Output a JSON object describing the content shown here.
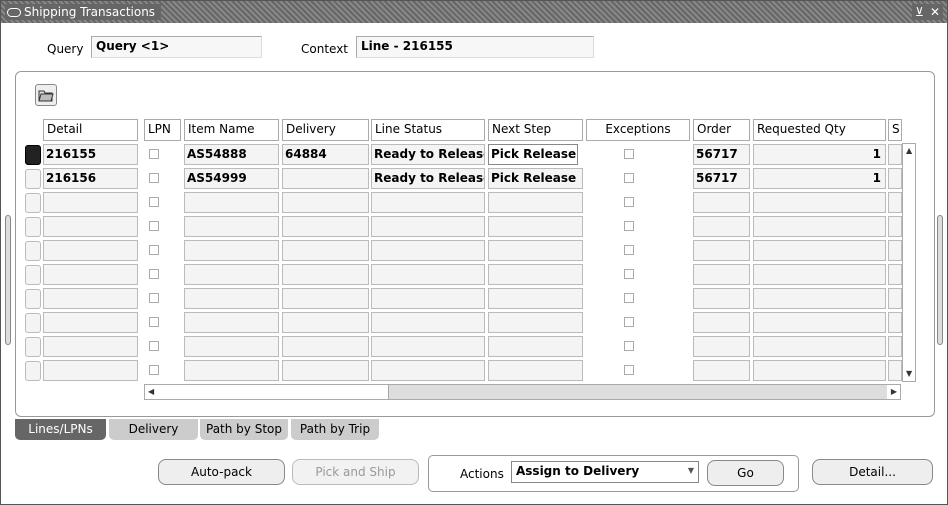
{
  "window": {
    "title": "Shipping Transactions",
    "controls": [
      "⊻",
      "✕"
    ]
  },
  "query": {
    "label": "Query",
    "value": "Query <1>"
  },
  "context": {
    "label": "Context",
    "value": "Line - 216155"
  },
  "table": {
    "headers": [
      "Detail",
      "LPN",
      "Item Name",
      "Delivery",
      "Line Status",
      "Next Step",
      "Exceptions",
      "Order",
      "Requested Qty",
      "S"
    ],
    "rows": [
      {
        "detail": "216155",
        "item": "AS54888",
        "delivery": "64884",
        "status": "Ready to Release",
        "next": "Pick Release",
        "order": "56717",
        "qty": "1"
      },
      {
        "detail": "216156",
        "item": "AS54999",
        "delivery": "",
        "status": "Ready to Release",
        "next": "Pick Release",
        "order": "56717",
        "qty": "1"
      }
    ]
  },
  "tabs": [
    "Lines/LPNs",
    "Delivery",
    "Path by Stop",
    "Path by Trip"
  ],
  "buttons": {
    "autopack": "Auto-pack",
    "pickship": "Pick and Ship",
    "go": "Go",
    "detail": "Detail..."
  },
  "actions": {
    "label": "Actions",
    "value": "Assign to Delivery"
  }
}
